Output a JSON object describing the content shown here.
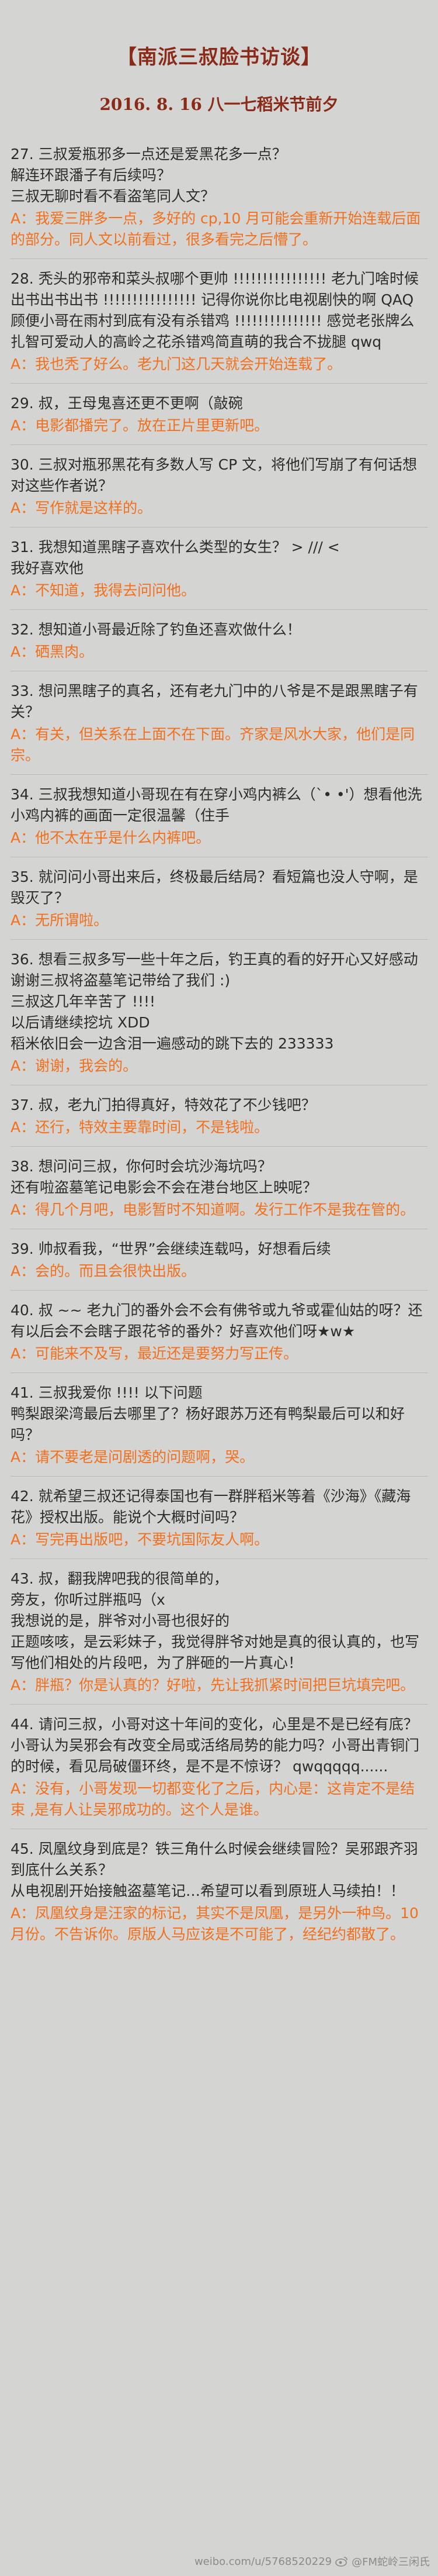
{
  "header": {
    "title": "【南派三叔脸书访谈】",
    "subtitle": "2016. 8. 16   八一七稻米节前夕"
  },
  "qa": [
    {
      "q": "27. 三叔爱瓶邪多一点还是爱黑花多一点？\n解连环跟潘子有后续吗？\n三叔无聊时看不看盗笔同人文？",
      "a": "A：我爱三胖多一点，多好的 cp,10 月可能会重新开始连载后面的部分。同人文以前看过，很多看完之后懵了。"
    },
    {
      "q": "28. 秃头的邪帝和菜头叔哪个更帅 !!!!!!!!!!!!!!!! 老九门啥时候出书出书出书 !!!!!!!!!!!!!!!! 记得你说你比电视剧快的啊 QAQ\n顾便小哥在雨村到底有没有杀错鸡 !!!!!!!!!!!!!!! 感觉老张牌么扎智可爱动人的高岭之花杀错鸡简直萌的我合不拢腿 qwq",
      "a": "A：我也秃了好么。老九门这几天就会开始连载了。"
    },
    {
      "q": "29. 叔，王母鬼喜还更不更啊（敲碗",
      "a": "A：电影都播完了。放在正片里更新吧。"
    },
    {
      "q": "30. 三叔对瓶邪黑花有多数人写 CP 文，将他们写崩了有何话想对这些作者说？",
      "a": "A：写作就是这样的。"
    },
    {
      "q": "31. 我想知道黑瞎子喜欢什么类型的女生？ > /// <\n我好喜欢他",
      "a": "A：不知道，我得去问问他。"
    },
    {
      "q": "32. 想知道小哥最近除了钓鱼还喜欢做什么！",
      "a": "A：硒黑肉。"
    },
    {
      "q": "33. 想问黑瞎子的真名，还有老九门中的八爷是不是跟黑瞎子有关？",
      "a": "A：有关，但关系在上面不在下面。齐家是风水大家，他们是同宗。"
    },
    {
      "q": "34. 三叔我想知道小哥现在有在穿小鸡内裤么（`• •'）想看他洗小鸡内裤的画面一定很温馨（住手",
      "a": "A：他不太在乎是什么内裤吧。"
    },
    {
      "q": "35. 就问问小哥出来后，终极最后结局？看短篇也没人守啊，是毁灭了？",
      "a": "A：无所谓啦。"
    },
    {
      "q": "36. 想看三叔多写一些十年之后，钓王真的看的好开心又好感动\n谢谢三叔将盗墓笔记带给了我们 :)\n三叔这几年辛苦了 !!!!\n以后请继续挖坑 XDD\n稻米依旧会一边含泪一遍感动的跳下去的 233333",
      "a": "A：谢谢，我会的。"
    },
    {
      "q": "37. 叔，老九门拍得真好，特效花了不少钱吧？",
      "a": "A：还行，特效主要靠时间，不是钱啦。"
    },
    {
      "q": "38. 想问问三叔，你何时会坑沙海坑吗？\n还有啦盗墓笔记电影会不会在港台地区上映呢？",
      "a": "A：得几个月吧，电影暂时不知道啊。发行工作不是我在管的。"
    },
    {
      "q": "39. 帅叔看我，“世界”会继续连载吗，好想看后续",
      "a": "A：会的。而且会很快出版。"
    },
    {
      "q": "40. 叔 ~~ 老九门的番外会不会有佛爷或九爷或霍仙姑的呀？还有以后会不会瞎子跟花爷的番外？好喜欢他们呀★w★",
      "a": "A：可能来不及写，最近还是要努力写正传。"
    },
    {
      "q": "41. 三叔我爱你 !!!! 以下问题\n鸭梨跟梁湾最后去哪里了？杨好跟苏万还有鸭梨最后可以和好吗？",
      "a": "A：请不要老是问剧透的问题啊，哭。"
    },
    {
      "q": "42. 就希望三叔还记得泰国也有一群胖稻米等着《沙海》《藏海花》授权出版。能说个大概时间吗？",
      "a": "A：写完再出版吧，不要坑国际友人啊。"
    },
    {
      "q": "43. 叔，翻我牌吧我的很简单的，\n旁友，你听过胖瓶吗（x\n我想说的是，胖爷对小哥也很好的\n正题咳咳，是云彩妹子，我觉得胖爷对她是真的很认真的，也写写他们相处的片段吧，为了胖砸的一片真心！",
      "a": "A：胖瓶？你是认真的？好啦，先让我抓紧时间把巨坑填完吧。"
    },
    {
      "q": "44. 请问三叔，小哥对这十年间的变化，心里是不是已经有底？小哥认为吴邪会有改变全局或活络局势的能力吗？小哥出青铜门的时候，看见局破僵环终，是不是不惊讶？ qwqqqqq......",
      "a": "A：没有，小哥发现一切都变化了之后，内心是：这肯定不是结束 ,是有人让吴邪成功的。这个人是谁。"
    },
    {
      "q": "45. 凤凰纹身到底是？铁三角什么时候会继续冒险？吴邪跟齐羽到底什么关系？\n从电视剧开始接触盗墓笔记…希望可以看到原班人马续拍！！",
      "a": "A：凤凰纹身是汪家的标记，其实不是凤凰，是另外一种鸟。10 月份。不告诉你。原版人马应该是不可能了，经纪约都散了。"
    }
  ],
  "footer": {
    "watermark": "weibo.com/u/5768520229",
    "handle": "@FM蛇岭三闲氏"
  }
}
